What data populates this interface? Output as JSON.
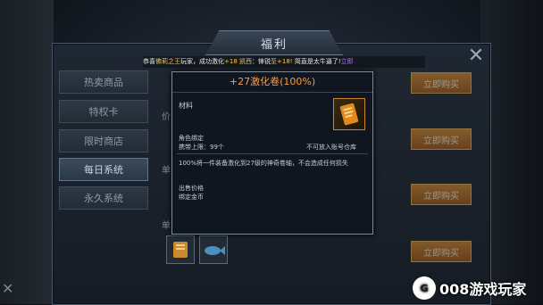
{
  "window": {
    "title": "福利"
  },
  "marquee": {
    "prefix": "恭喜",
    "player": "佛莉之王",
    "mid1": "玩家，成功激化",
    "item1": "+18 凯西",
    "mid2": "：锋锐",
    "item2": "至+18!",
    "suffix": " 简直是太牛逼了!",
    "link": "立即"
  },
  "sidebar": {
    "tabs": [
      {
        "label": "热卖商品"
      },
      {
        "label": "特权卡"
      },
      {
        "label": "限时商店"
      },
      {
        "label": "每日系统"
      },
      {
        "label": "永久系统"
      }
    ],
    "active_index": 3
  },
  "shop": {
    "buy_label": "立即购买",
    "row_labels": [
      "价",
      "单",
      "单"
    ]
  },
  "tooltip": {
    "title": "+27激化卷(100%)",
    "type": "材料",
    "bind": "角色绑定",
    "max_label": "携带上限：",
    "max_value": "99个",
    "no_storage": "不可放入账号仓库",
    "description": "100%将一件装备激化到27级的神奇卷轴，不会造成任何损失",
    "price_label": "出售价格",
    "price_value": "绑定金币"
  },
  "watermark": {
    "logo": "G",
    "text": "008游戏玩家"
  },
  "icons": {
    "close": "close-icon",
    "item": "scroll-icon",
    "corner": "corner-x-icon"
  },
  "colors": {
    "tooltip_title": "#ff9a3c",
    "highlight": "#f4c542",
    "link": "#b36bff",
    "button": "#d88a2a"
  }
}
